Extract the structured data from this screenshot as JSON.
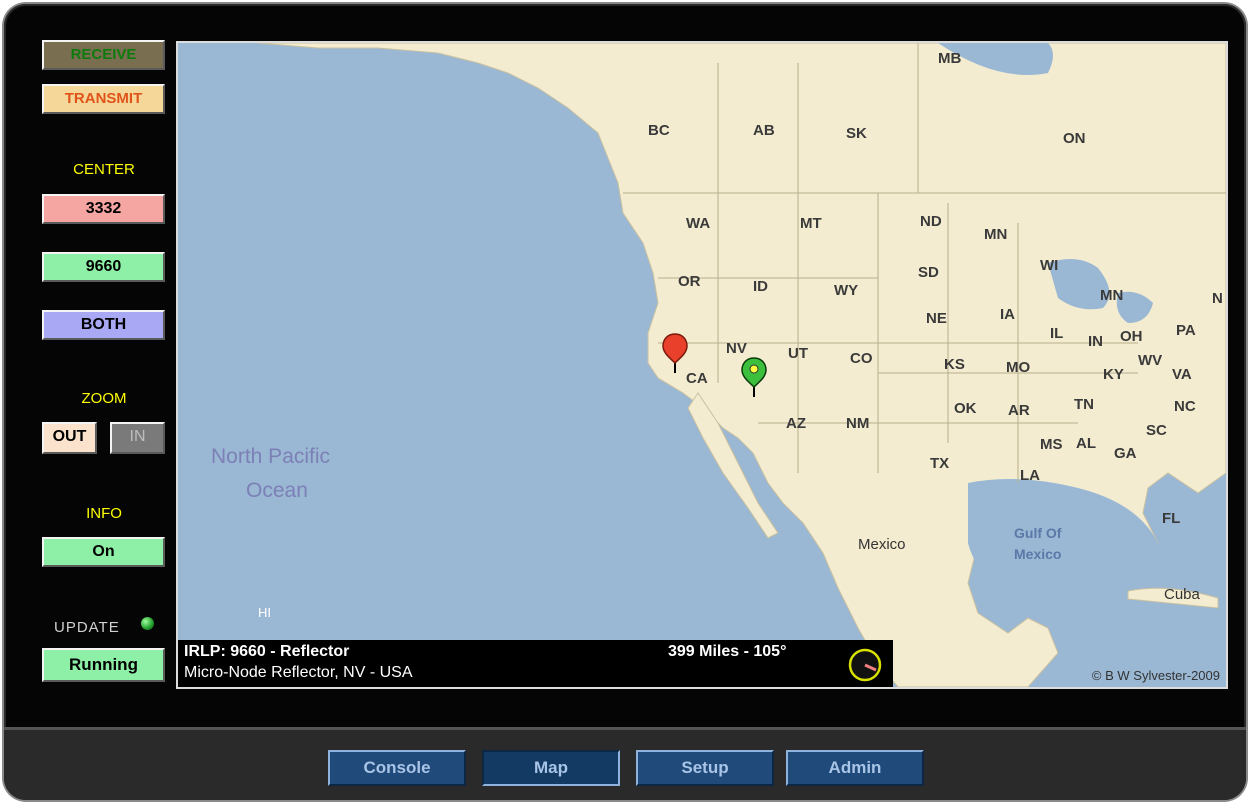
{
  "controls": {
    "receive": "RECEIVE",
    "transmit": "TRANSMIT",
    "center_label": "CENTER",
    "center_a": "3332",
    "center_b": "9660",
    "center_both": "BOTH",
    "zoom_label": "ZOOM",
    "zoom_out": "OUT",
    "zoom_in": "IN",
    "info_label": "INFO",
    "info_value": "On",
    "update_label": "UPDATE",
    "update_value": "Running"
  },
  "map": {
    "labels": {
      "mb": "MB",
      "bc": "BC",
      "ab": "AB",
      "sk": "SK",
      "on": "ON",
      "wa": "WA",
      "mt": "MT",
      "nd": "ND",
      "mn": "MN",
      "wi": "WI",
      "or": "OR",
      "id": "ID",
      "wy": "WY",
      "sd": "SD",
      "mi": "MN",
      "ny": "N",
      "ne": "NE",
      "ia": "IA",
      "il": "IL",
      "in": "IN",
      "oh": "OH",
      "pa": "PA",
      "nv": "NV",
      "ut": "UT",
      "co": "CO",
      "ks": "KS",
      "mo": "MO",
      "wv": "WV",
      "ky": "KY",
      "va": "VA",
      "ca": "CA",
      "az": "AZ",
      "nm": "NM",
      "ok": "OK",
      "ar": "AR",
      "tn": "TN",
      "nc": "NC",
      "sc": "SC",
      "ms": "MS",
      "al": "AL",
      "ga": "GA",
      "tx": "TX",
      "la": "LA",
      "fl": "FL",
      "mexico": "Mexico",
      "gulf1": "Gulf Of",
      "gulf2": "Mexico",
      "cuba": "Cuba",
      "hi": "HI",
      "ocean1": "North Pacific",
      "ocean2": "Ocean"
    },
    "info": {
      "node": "IRLP: 9660 - Reflector",
      "location": "Micro-Node Reflector, NV - USA",
      "distance": "399 Miles - 105°"
    },
    "copyright": "© B W Sylvester-2009",
    "colors": {
      "water": "#9ab8d4",
      "land": "#f3ecd0",
      "pin_red": "#e8402a",
      "pin_green": "#3cbf3c"
    }
  },
  "nav": {
    "console": "Console",
    "map": "Map",
    "setup": "Setup",
    "admin": "Admin"
  }
}
